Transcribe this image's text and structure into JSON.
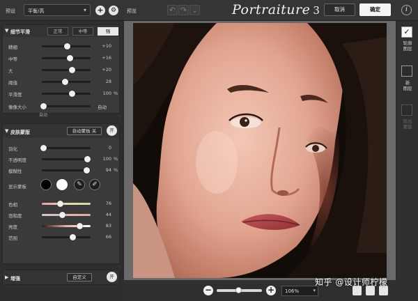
{
  "topbar": {
    "preset_label": "预设",
    "preset_value": "平衡/高",
    "preview_label": "预览",
    "brand_name": "Portraiture",
    "brand_version": "3",
    "cancel_label": "取消",
    "ok_label": "确定",
    "info_glyph": "i"
  },
  "detail_smoothing": {
    "title": "细节平滑",
    "levels": [
      "正常",
      "中等",
      "强"
    ],
    "active_level": "强",
    "sliders": [
      {
        "label": "精细",
        "value": "+10",
        "pos": 0.52
      },
      {
        "label": "中等",
        "value": "+16",
        "pos": 0.58
      },
      {
        "label": "大",
        "value": "+20",
        "pos": 0.62
      },
      {
        "label": "阈值",
        "value": "28",
        "pos": 0.48
      },
      {
        "label": "平滑度",
        "value": "100",
        "unit": "%",
        "pos": 0.62
      }
    ],
    "radius_label": "像像大小",
    "radius_min_label": "自动",
    "radius_right_label": "自动",
    "radius_pos": 0.04
  },
  "skin_mask": {
    "title": "皮肤蒙版",
    "auto_mask_label": "自动蒙板 关",
    "toggle_label": "开",
    "sliders_top": [
      {
        "label": "羽化",
        "value": "0",
        "pos": 0.04
      },
      {
        "label": "不透明度",
        "value": "100",
        "unit": "%",
        "pos": 0.94
      },
      {
        "label": "模糊性",
        "value": "94",
        "unit": "%",
        "pos": 0.92
      }
    ],
    "show_mask_label": "显示蒙板",
    "mask_colors": [
      "#000000",
      "#ffffff"
    ],
    "sliders_color": [
      {
        "label": "色相",
        "value": "76",
        "pos": 0.38
      },
      {
        "label": "饱和度",
        "value": "44",
        "pos": 0.42
      },
      {
        "label": "亮度",
        "value": "83",
        "pos": 0.78
      },
      {
        "label": "范围",
        "value": "66",
        "pos": 0.64
      }
    ]
  },
  "enhance": {
    "title": "增强",
    "preset_label": "自定义",
    "toggle_label": "开"
  },
  "right_rail": {
    "items": [
      {
        "label": "轮廓\n图层",
        "checked": true,
        "dim": false
      },
      {
        "label": "新\n图层",
        "checked": false,
        "dim": false
      },
      {
        "label": "现出\n蒙版",
        "checked": false,
        "dim": true
      }
    ]
  },
  "bottombar": {
    "zoom_out": "−",
    "zoom_in": "+",
    "zoom_pos": 0.48,
    "zoom_value": "106%"
  },
  "watermark": "知乎 @设计师柠檬",
  "colors": {
    "accent_active": "#e8e8e8",
    "panel": "#3a3a3a",
    "canvas_gray": "#6a6a6a"
  }
}
